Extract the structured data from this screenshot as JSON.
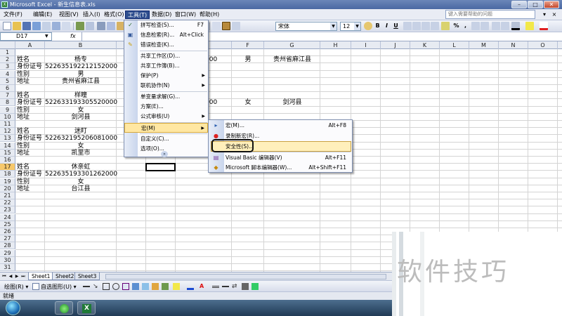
{
  "window": {
    "title": "Microsoft Excel - 新生信息表.xls",
    "min": "–",
    "max": "□",
    "close": "✕"
  },
  "menu": {
    "items": [
      "文件(F)",
      "编辑(E)",
      "视图(V)",
      "插入(I)",
      "格式(O)",
      "工具(T)",
      "数据(D)",
      "窗口(W)",
      "帮助(H)"
    ],
    "active_index": 5,
    "help_placeholder": "键入需要帮助的问题",
    "doc_close": "×"
  },
  "toolbar": {
    "font_name": "宋体",
    "font_size": "12",
    "bold": "B",
    "italic": "I",
    "underline": "U",
    "percent": "%",
    "comma": ","
  },
  "formula_bar": {
    "name_box": "D17",
    "fx": "fx"
  },
  "columns": [
    "A",
    "B",
    "C",
    "D",
    "E",
    "F",
    "G",
    "H",
    "I",
    "J",
    "K",
    "L",
    "M",
    "N",
    "O"
  ],
  "rows": [
    "1",
    "2",
    "3",
    "4",
    "5",
    "6",
    "7",
    "8",
    "9",
    "10",
    "11",
    "12",
    "13",
    "14",
    "15",
    "16",
    "17",
    "18",
    "19",
    "20",
    "21",
    "22",
    "23",
    "24",
    "25",
    "26",
    "27",
    "28",
    "29",
    "30",
    "31"
  ],
  "selected_row": "17",
  "cells": [
    {
      "r": 2,
      "c": "A",
      "v": "姓名"
    },
    {
      "r": 2,
      "c": "B",
      "v": "杨专"
    },
    {
      "r": 3,
      "c": "A",
      "v": "身份证号"
    },
    {
      "r": 3,
      "c": "B",
      "v": "522635192212152000"
    },
    {
      "r": 4,
      "c": "A",
      "v": "性别"
    },
    {
      "r": 4,
      "c": "B",
      "v": "男"
    },
    {
      "r": 5,
      "c": "A",
      "v": "地址"
    },
    {
      "r": 5,
      "c": "B",
      "v": "贵州省麻江县"
    },
    {
      "r": 2,
      "c": "E",
      "v": "2212152000"
    },
    {
      "r": 2,
      "c": "F",
      "v": "男"
    },
    {
      "r": 2,
      "c": "G",
      "v": "贵州省麻江县"
    },
    {
      "r": 7,
      "c": "A",
      "v": "姓名"
    },
    {
      "r": 7,
      "c": "B",
      "v": "样瞳"
    },
    {
      "r": 8,
      "c": "A",
      "v": "身份证号"
    },
    {
      "r": 8,
      "c": "B",
      "v": "522633193305520000"
    },
    {
      "r": 9,
      "c": "A",
      "v": "性别"
    },
    {
      "r": 9,
      "c": "B",
      "v": "女"
    },
    {
      "r": 10,
      "c": "A",
      "v": "地址"
    },
    {
      "r": 10,
      "c": "B",
      "v": "剑河县"
    },
    {
      "r": 8,
      "c": "E",
      "v": "3305520000"
    },
    {
      "r": 8,
      "c": "F",
      "v": "女"
    },
    {
      "r": 8,
      "c": "G",
      "v": "剑河县"
    },
    {
      "r": 12,
      "c": "A",
      "v": "姓名"
    },
    {
      "r": 12,
      "c": "B",
      "v": "迷盯"
    },
    {
      "r": 13,
      "c": "A",
      "v": "身份证号"
    },
    {
      "r": 13,
      "c": "B",
      "v": "522632195206081000"
    },
    {
      "r": 14,
      "c": "A",
      "v": "性别"
    },
    {
      "r": 14,
      "c": "B",
      "v": "女"
    },
    {
      "r": 15,
      "c": "A",
      "v": "地址"
    },
    {
      "r": 15,
      "c": "B",
      "v": "凯里市"
    },
    {
      "r": 17,
      "c": "A",
      "v": "姓名"
    },
    {
      "r": 17,
      "c": "B",
      "v": "休亲虹"
    },
    {
      "r": 18,
      "c": "A",
      "v": "身份证号"
    },
    {
      "r": 18,
      "c": "B",
      "v": "522635193301262000"
    },
    {
      "r": 19,
      "c": "A",
      "v": "性别"
    },
    {
      "r": 19,
      "c": "B",
      "v": "女"
    },
    {
      "r": 20,
      "c": "A",
      "v": "地址"
    },
    {
      "r": 20,
      "c": "B",
      "v": "台江县"
    }
  ],
  "tools_menu": [
    {
      "label": "拼写检查(S)...",
      "shortcut": "F7",
      "icon": "spellcheck-icon"
    },
    {
      "label": "信息检索(R)...",
      "shortcut": "Alt+Click",
      "icon": "research-icon"
    },
    {
      "label": "错误检查(K)...",
      "shortcut": "",
      "icon": "error-check-icon"
    },
    {
      "label": "共享工作区(D)...",
      "shortcut": "",
      "icon": ""
    },
    {
      "label": "共享工作簿(B)...",
      "shortcut": "",
      "icon": ""
    },
    {
      "label": "保护(P)",
      "shortcut": "",
      "icon": "",
      "submenu": true
    },
    {
      "label": "联机协作(N)",
      "shortcut": "",
      "icon": "",
      "submenu": true
    },
    {
      "label": "单变量求解(G)...",
      "shortcut": "",
      "icon": ""
    },
    {
      "label": "方案(E)...",
      "shortcut": "",
      "icon": ""
    },
    {
      "label": "公式审核(U)",
      "shortcut": "",
      "icon": "",
      "submenu": true
    },
    {
      "label": "宏(M)",
      "shortcut": "",
      "icon": "",
      "submenu": true,
      "highlight": true
    },
    {
      "label": "自定义(C)...",
      "shortcut": "",
      "icon": ""
    },
    {
      "label": "选项(O)...",
      "shortcut": "",
      "icon": ""
    }
  ],
  "macro_menu": [
    {
      "label": "宏(M)...",
      "shortcut": "Alt+F8",
      "icon": "play-icon"
    },
    {
      "label": "录制新宏(R)...",
      "shortcut": "",
      "icon": "record-icon"
    },
    {
      "label": "安全性(S)...",
      "shortcut": "",
      "icon": ""
    },
    {
      "label": "Visual Basic 编辑器(V)",
      "shortcut": "Alt+F11",
      "icon": "vb-editor-icon"
    },
    {
      "label": "Microsoft 脚本编辑器(W)...",
      "shortcut": "Alt+Shift+F11",
      "icon": "script-editor-icon"
    }
  ],
  "sheets": [
    "Sheet1",
    "Sheet2",
    "Sheet3"
  ],
  "active_sheet": "Sheet1",
  "draw_toolbar": {
    "draw": "绘图(R) ▾",
    "autoshapes": "自选图形(U) ▾"
  },
  "status": "就绪",
  "watermark": "软件技巧"
}
